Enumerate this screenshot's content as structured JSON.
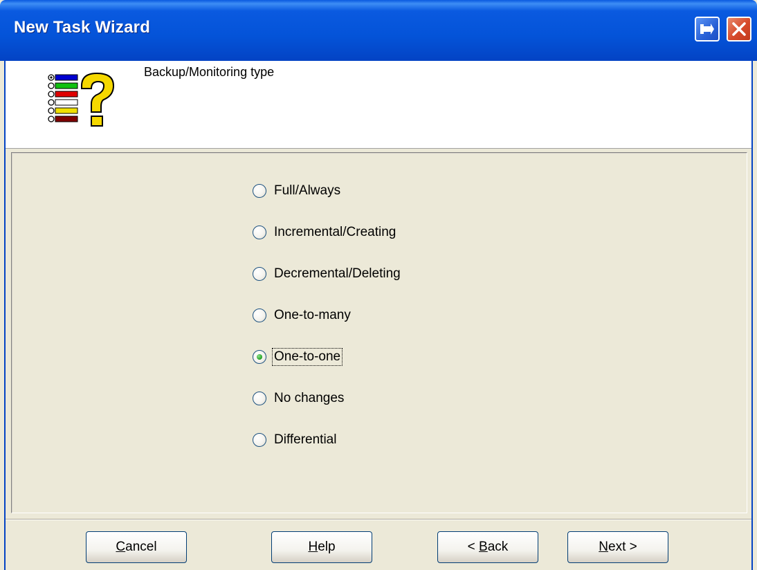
{
  "window": {
    "title": "New Task Wizard"
  },
  "header": {
    "title": "Backup/Monitoring type"
  },
  "options": [
    {
      "label": "Full/Always",
      "checked": false
    },
    {
      "label": "Incremental/Creating",
      "checked": false
    },
    {
      "label": "Decremental/Deleting",
      "checked": false
    },
    {
      "label": "One-to-many",
      "checked": false
    },
    {
      "label": "One-to-one",
      "checked": true
    },
    {
      "label": "No changes",
      "checked": false
    },
    {
      "label": "Differential",
      "checked": false
    }
  ],
  "buttons": {
    "cancel": {
      "mnemonic": "C",
      "rest": "ancel"
    },
    "help": {
      "mnemonic": "H",
      "rest": "elp"
    },
    "back": {
      "prefix": "< ",
      "mnemonic": "B",
      "rest": "ack"
    },
    "next": {
      "mnemonic": "N",
      "rest": "ext >"
    }
  },
  "colors": {
    "titlebar": "#0453d8",
    "body": "#ece9d8",
    "radio_dot": "#21a121"
  },
  "icons": [
    "wizard-list-question-icon",
    "pin-icon",
    "close-icon"
  ]
}
